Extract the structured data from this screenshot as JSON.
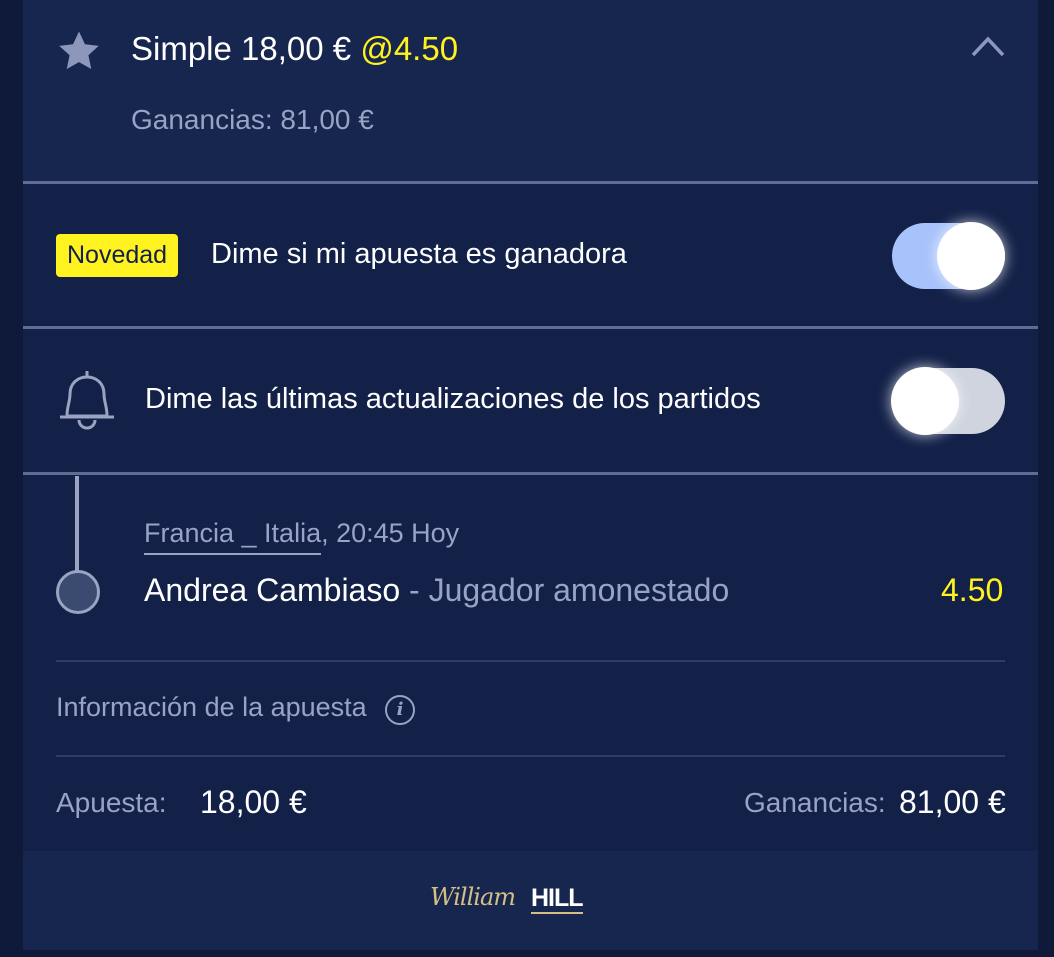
{
  "bet": {
    "type_label": "Simple",
    "stake_amount": "18,00 €",
    "odds_label": "@4.50",
    "winnings_line": "Ganancias: 81,00 €"
  },
  "notifications": {
    "win_badge": "Novedad",
    "win_label": "Dime si mi apuesta es ganadora",
    "win_toggle_on": true,
    "updates_label": "Dime las últimas actualizaciones de los partidos",
    "updates_toggle_on": false
  },
  "selection": {
    "match_link": "Francia _ Italia",
    "match_time": ", 20:45 Hoy",
    "player": "Andrea Cambiaso",
    "separator": " - ",
    "market": "Jugador amonestado",
    "odds": "4.50"
  },
  "info": {
    "label": "Información de la apuesta",
    "icon_glyph": "i"
  },
  "summary": {
    "stake_label": "Apuesta:",
    "stake_value": "18,00 €",
    "win_label": "Ganancias:",
    "win_value": "81,00 €"
  },
  "footer": {
    "logo_script": "William",
    "logo_block": "HILL"
  },
  "colors": {
    "accent_yellow": "#fff21e",
    "background": "#132149",
    "toggle_on": "#a8c3fb"
  }
}
